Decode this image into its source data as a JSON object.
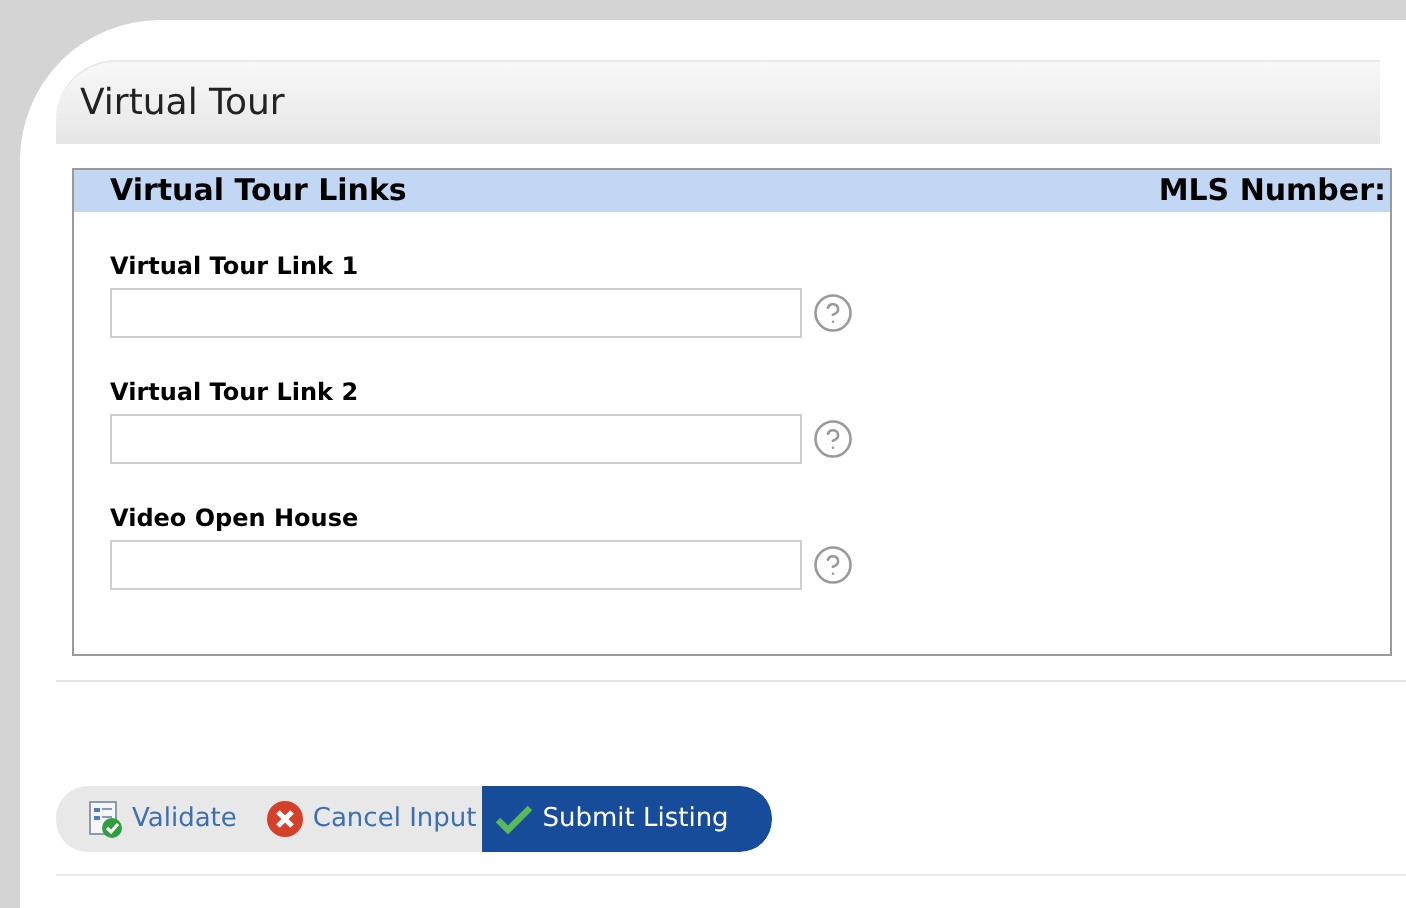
{
  "page": {
    "title": "Virtual Tour"
  },
  "section": {
    "title": "Virtual Tour Links",
    "mls_label": "MLS Number:"
  },
  "fields": [
    {
      "label": "Virtual Tour Link 1"
    },
    {
      "label": "Virtual Tour Link 2"
    },
    {
      "label": "Video Open House"
    }
  ],
  "actions": [
    {
      "kind": "validate",
      "label": "Validate"
    },
    {
      "kind": "cancel",
      "label": "Cancel Input"
    },
    {
      "kind": "submit",
      "label": "Submit Listing"
    }
  ]
}
